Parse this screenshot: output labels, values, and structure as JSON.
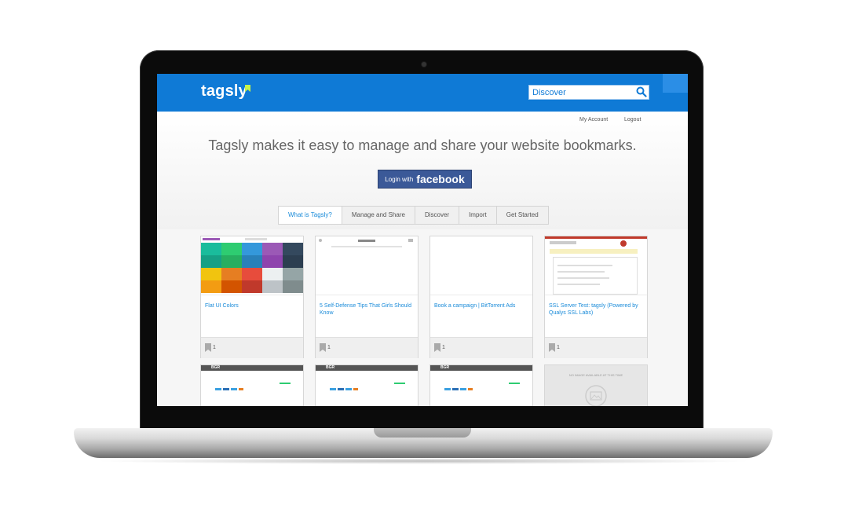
{
  "header": {
    "logo": "tagsly",
    "search_placeholder": "Discover"
  },
  "account": {
    "my_account": "My Account",
    "logout": "Logout"
  },
  "hero": {
    "headline": "Tagsly makes it easy to manage and share your website bookmarks.",
    "login_small": "Login with",
    "login_big": "facebook"
  },
  "tabs": [
    {
      "label": "What is Tagsly?",
      "active": true
    },
    {
      "label": "Manage and Share",
      "active": false
    },
    {
      "label": "Discover",
      "active": false
    },
    {
      "label": "Import",
      "active": false
    },
    {
      "label": "Get Started",
      "active": false
    }
  ],
  "cards": [
    {
      "title": "Flat UI Colors",
      "count": "1"
    },
    {
      "title": "5 Self-Defense Tips That Girls Should Know",
      "count": "1"
    },
    {
      "title": "Book a campaign | BitTorrent Ads",
      "count": "1"
    },
    {
      "title": "SSL Server Test: tagsly (Powered by Qualys SSL Labs)",
      "count": "1"
    }
  ],
  "row2": {
    "bgr_label": "BGR",
    "no_image_label": "NO IMAGE AVAILABLE AT THIS TIME"
  },
  "colors": {
    "brand": "#0f7ad6",
    "facebook": "#3b5998",
    "link": "#1a8bd9"
  }
}
